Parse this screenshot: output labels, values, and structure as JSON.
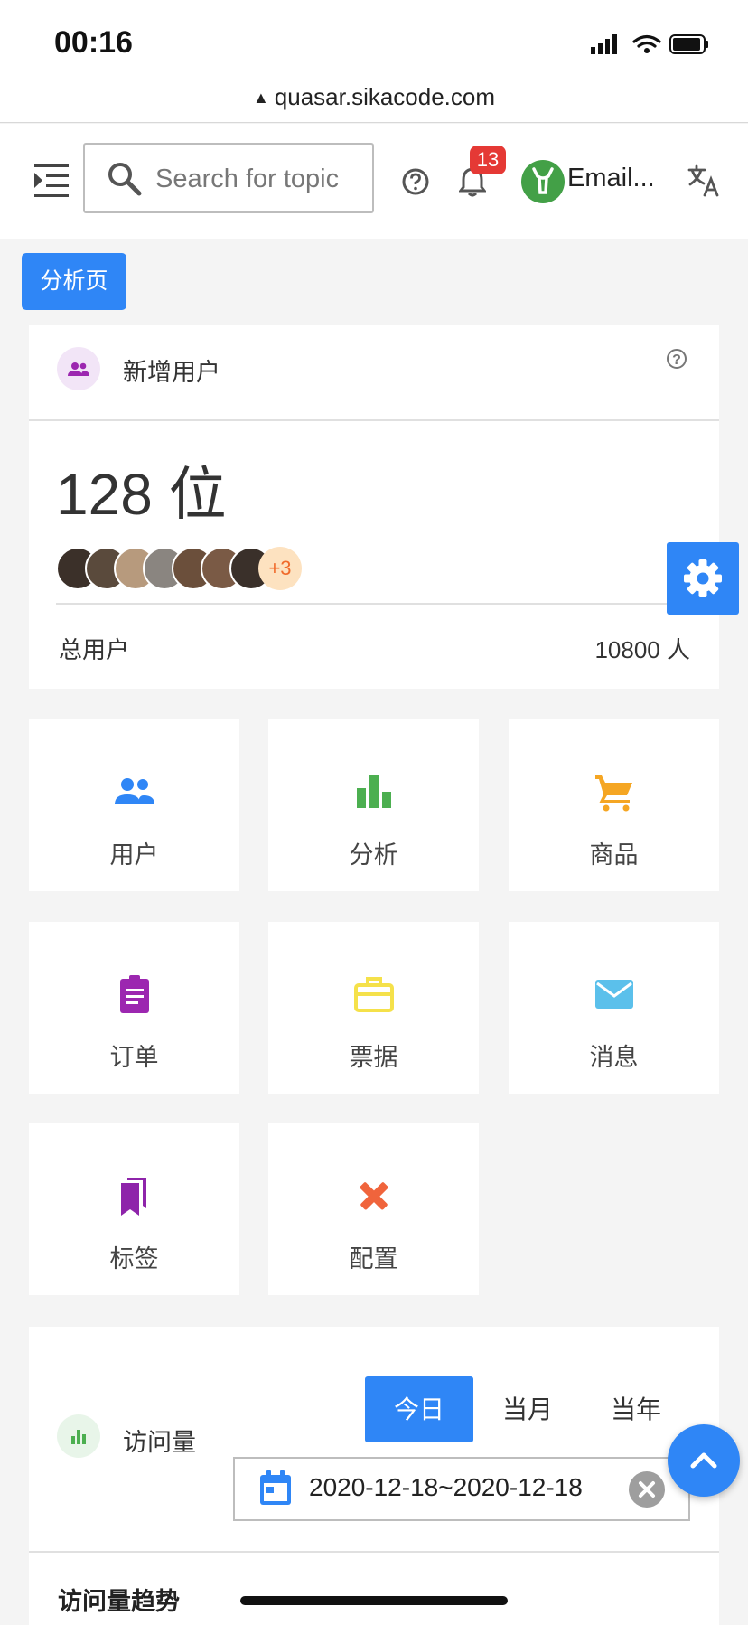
{
  "status_bar": {
    "time": "00:16",
    "url": "quasar.sikacode.com"
  },
  "toolbar": {
    "search_placeholder": "Search for topic",
    "notification_count": "13",
    "user_label": "Email..."
  },
  "page_tag": "分析页",
  "new_users_card": {
    "title": "新增用户",
    "count": "128 位",
    "more_avatars": "+3",
    "total_label": "总用户",
    "total_value": "10800 人"
  },
  "shortcuts": [
    {
      "label": "用户",
      "icon": "people-icon",
      "color": "#2f86f6"
    },
    {
      "label": "分析",
      "icon": "bar-chart-icon",
      "color": "#4caf50"
    },
    {
      "label": "商品",
      "icon": "cart-icon",
      "color": "#f5a623"
    },
    {
      "label": "订单",
      "icon": "clipboard-icon",
      "color": "#9c27b0"
    },
    {
      "label": "票据",
      "icon": "briefcase-icon",
      "color": "#f5e14a"
    },
    {
      "label": "消息",
      "icon": "mail-icon",
      "color": "#5bc0eb"
    },
    {
      "label": "标签",
      "icon": "bookmarks-icon",
      "color": "#8e24aa"
    },
    {
      "label": "配置",
      "icon": "tools-icon",
      "color": "#f0643c"
    }
  ],
  "visits_card": {
    "title": "访问量",
    "tabs": [
      "今日",
      "当月",
      "当年"
    ],
    "active_tab": "今日",
    "date_range": "2020-12-18~2020-12-18",
    "trend_title": "访问量趋势"
  }
}
